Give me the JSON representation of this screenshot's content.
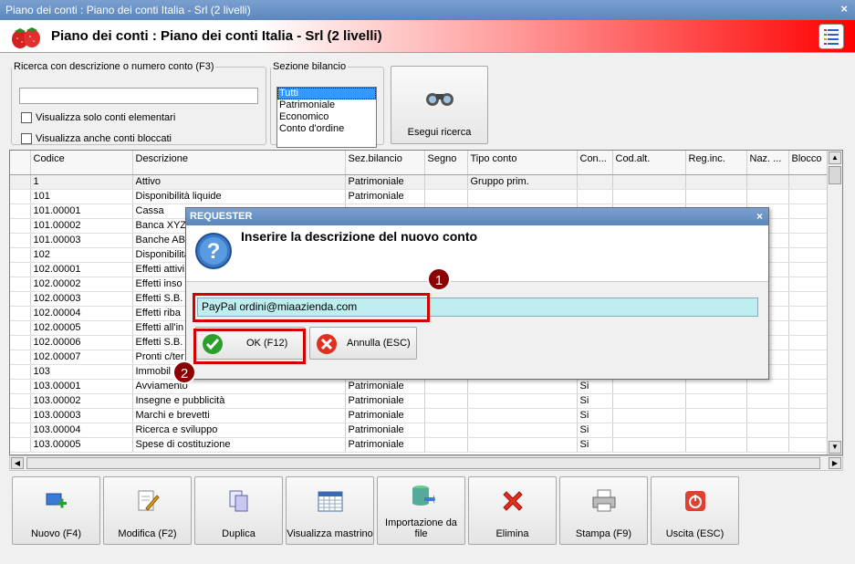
{
  "window": {
    "title": "Piano dei conti : Piano dei conti Italia - Srl (2 livelli)",
    "close": "×"
  },
  "header": {
    "title": "Piano dei conti : Piano dei conti Italia - Srl (2 livelli)"
  },
  "search": {
    "legend": "Ricerca con descrizione o numero conto (F3)",
    "value": "",
    "chk_elementari": "Visualizza solo conti elementari",
    "chk_bloccati": "Visualizza anche conti bloccati"
  },
  "sezione": {
    "legend": "Sezione bilancio",
    "options": [
      "Tutti",
      "Patrimoniale",
      "Economico",
      "Conto d'ordine"
    ],
    "selected": "Tutti"
  },
  "esegui": {
    "label": "Esegui ricerca"
  },
  "grid": {
    "columns": [
      "Codice",
      "Descrizione",
      "Sez.bilancio",
      "Segno",
      "Tipo conto",
      "Con...",
      "Cod.alt.",
      "Reg.inc.",
      "Naz. ...",
      "Blocco"
    ],
    "rows": [
      [
        "1",
        "Attivo",
        "Patrimoniale",
        "",
        "Gruppo prim.",
        "",
        "",
        "",
        "",
        ""
      ],
      [
        "101",
        "Disponibilità liquide",
        "Patrimoniale",
        "",
        "",
        "",
        "",
        "",
        "",
        ""
      ],
      [
        "101.00001",
        "Cassa",
        "",
        "",
        "",
        "",
        "",
        "",
        "",
        ""
      ],
      [
        "101.00002",
        "Banca XYZ",
        "",
        "",
        "",
        "",
        "",
        "",
        "",
        ""
      ],
      [
        "101.00003",
        "Banche ABC",
        "",
        "",
        "",
        "",
        "",
        "",
        "",
        ""
      ],
      [
        "102",
        "Disponibilità",
        "",
        "",
        "",
        "",
        "",
        "",
        "",
        ""
      ],
      [
        "102.00001",
        "Effetti attivi",
        "",
        "",
        "",
        "",
        "",
        "",
        "",
        ""
      ],
      [
        "102.00002",
        "Effetti inso",
        "",
        "",
        "",
        "",
        "",
        "",
        "",
        ""
      ],
      [
        "102.00003",
        "Effetti S.B.",
        "",
        "",
        "",
        "",
        "",
        "",
        "",
        ""
      ],
      [
        "102.00004",
        "Effetti riba",
        "",
        "",
        "",
        "",
        "",
        "",
        "",
        ""
      ],
      [
        "102.00005",
        "Effetti all'in",
        "",
        "",
        "",
        "",
        "",
        "",
        "",
        ""
      ],
      [
        "102.00006",
        "Effetti S.B.",
        "",
        "",
        "",
        "",
        "",
        "",
        "",
        ""
      ],
      [
        "102.00007",
        "Pronti c/ter",
        "",
        "",
        "",
        "",
        "",
        "",
        "",
        ""
      ],
      [
        "103",
        "Immobil",
        "",
        "",
        "",
        "",
        "",
        "",
        "",
        ""
      ],
      [
        "103.00001",
        "Avviamento",
        "Patrimoniale",
        "",
        "",
        "Si",
        "",
        "",
        "",
        ""
      ],
      [
        "103.00002",
        "Insegne e pubblicità",
        "Patrimoniale",
        "",
        "",
        "Si",
        "",
        "",
        "",
        ""
      ],
      [
        "103.00003",
        "Marchi e brevetti",
        "Patrimoniale",
        "",
        "",
        "Si",
        "",
        "",
        "",
        ""
      ],
      [
        "103.00004",
        "Ricerca e sviluppo",
        "Patrimoniale",
        "",
        "",
        "Si",
        "",
        "",
        "",
        ""
      ],
      [
        "103.00005",
        "Spese di costituzione",
        "Patrimoniale",
        "",
        "",
        "Si",
        "",
        "",
        "",
        ""
      ]
    ]
  },
  "toolbar": [
    {
      "label": "Nuovo (F4)",
      "icon": "new-icon"
    },
    {
      "label": "Modifica (F2)",
      "icon": "edit-icon"
    },
    {
      "label": "Duplica",
      "icon": "duplicate-icon"
    },
    {
      "label": "Visualizza mastrino",
      "icon": "calendar-icon"
    },
    {
      "label": "Importazione da file",
      "icon": "database-import-icon"
    },
    {
      "label": "Elimina",
      "icon": "delete-icon"
    },
    {
      "label": "Stampa (F9)",
      "icon": "printer-icon"
    },
    {
      "label": "Uscita (ESC)",
      "icon": "exit-icon"
    }
  ],
  "dialog": {
    "title": "REQUESTER",
    "close": "×",
    "message": "Inserire la descrizione del nuovo conto",
    "input_value": "PayPal ordini@miaazienda.com",
    "ok_label": "OK (F12)",
    "cancel_label": "Annulla (ESC)"
  },
  "markers": [
    "1",
    "2"
  ],
  "colors": {
    "accent_red": "#d40000",
    "title_blue": "#5c86bd",
    "input_cyan": "#bfeef0"
  }
}
